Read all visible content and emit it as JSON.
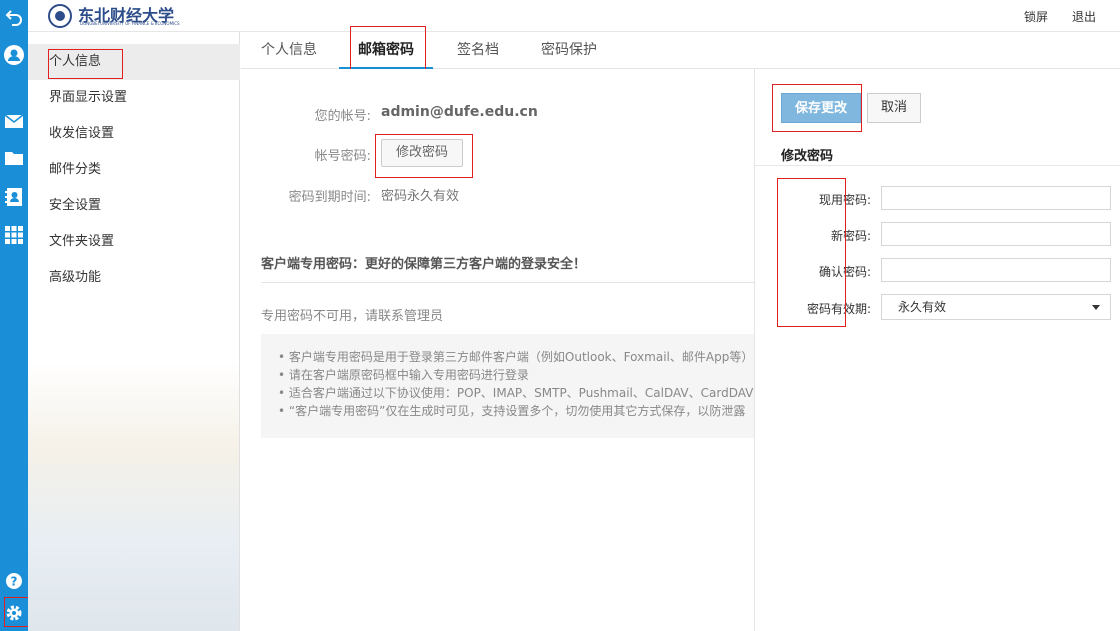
{
  "topbar": {
    "logo_text": "东北财经大学",
    "logo_subtext": "DONGBEI UNIVERSITY OF FINANCE & ECONOMICS",
    "lock_label": "锁屏",
    "logout_label": "退出"
  },
  "rail": {
    "icons": [
      "back-icon",
      "avatar-icon",
      "mail-icon",
      "folder-icon",
      "contacts-icon",
      "apps-icon",
      "help-icon",
      "settings-gear-icon"
    ],
    "accent": "#1a8fd8"
  },
  "settings_nav": {
    "items": [
      {
        "label": "个人信息"
      },
      {
        "label": "界面显示设置"
      },
      {
        "label": "收发信设置"
      },
      {
        "label": "邮件分类"
      },
      {
        "label": "安全设置"
      },
      {
        "label": "文件夹设置"
      },
      {
        "label": "高级功能"
      }
    ]
  },
  "tabs": [
    {
      "label": "个人信息"
    },
    {
      "label": "邮箱密码"
    },
    {
      "label": "签名档"
    },
    {
      "label": "密码保护"
    }
  ],
  "account": {
    "account_label": "您的帐号:",
    "account_value": "admin@dufe.edu.cn",
    "password_label": "帐号密码:",
    "change_password_button": "修改密码",
    "expiry_label": "密码到期时间:",
    "expiry_value": "密码永久有效"
  },
  "client_password": {
    "title": "客户端专用密码：更好的保障第三方客户端的登录安全！",
    "notice": "专用密码不可用，请联系管理员",
    "tips": [
      "• 客户端专用密码是用于登录第三方邮件客户端（例如Outlook、Foxmail、邮件App等）的",
      "• 请在客户端原密码框中输入专用密码进行登录",
      "• 适合客户端通过以下协议使用：POP、IMAP、SMTP、Pushmail、CalDAV、CardDAV",
      "• “客户端专用密码”仅在生成时可见，支持设置多个，切勿使用其它方式保存，以防泄露"
    ]
  },
  "side_panel": {
    "save_button": "保存更改",
    "cancel_button": "取消",
    "title": "修改密码",
    "current_password_label": "现用密码:",
    "new_password_label": "新密码:",
    "confirm_password_label": "确认密码:",
    "validity_label": "密码有效期:",
    "validity_selected": "永久有效"
  }
}
